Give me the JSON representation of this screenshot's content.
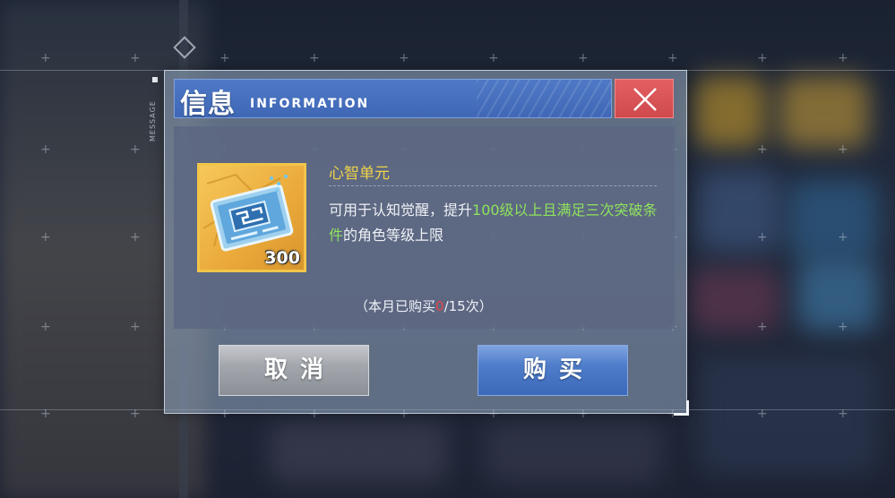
{
  "background": {
    "side_tag": "MESSAGE"
  },
  "dialog": {
    "title_cn": "信息",
    "title_en": "INFORMATION",
    "close_icon": "close-x-icon",
    "item": {
      "name": "心智单元",
      "quantity": "300",
      "description": {
        "prefix": "可用于认知觉醒，提升",
        "highlight": "100级以上且满足三次突破条件",
        "suffix": "的角色等级上限"
      },
      "purchase_count": {
        "prefix": "（本月已购买",
        "current": "0",
        "suffix": "/15次）"
      }
    },
    "buttons": {
      "cancel": "取消",
      "buy": "购买"
    }
  },
  "colors": {
    "header_blue": "#4f79c6",
    "close_red": "#e35f61",
    "item_name_yellow": "#f0d24a",
    "highlight_green": "#8fe35d",
    "count_red": "#e74646"
  }
}
